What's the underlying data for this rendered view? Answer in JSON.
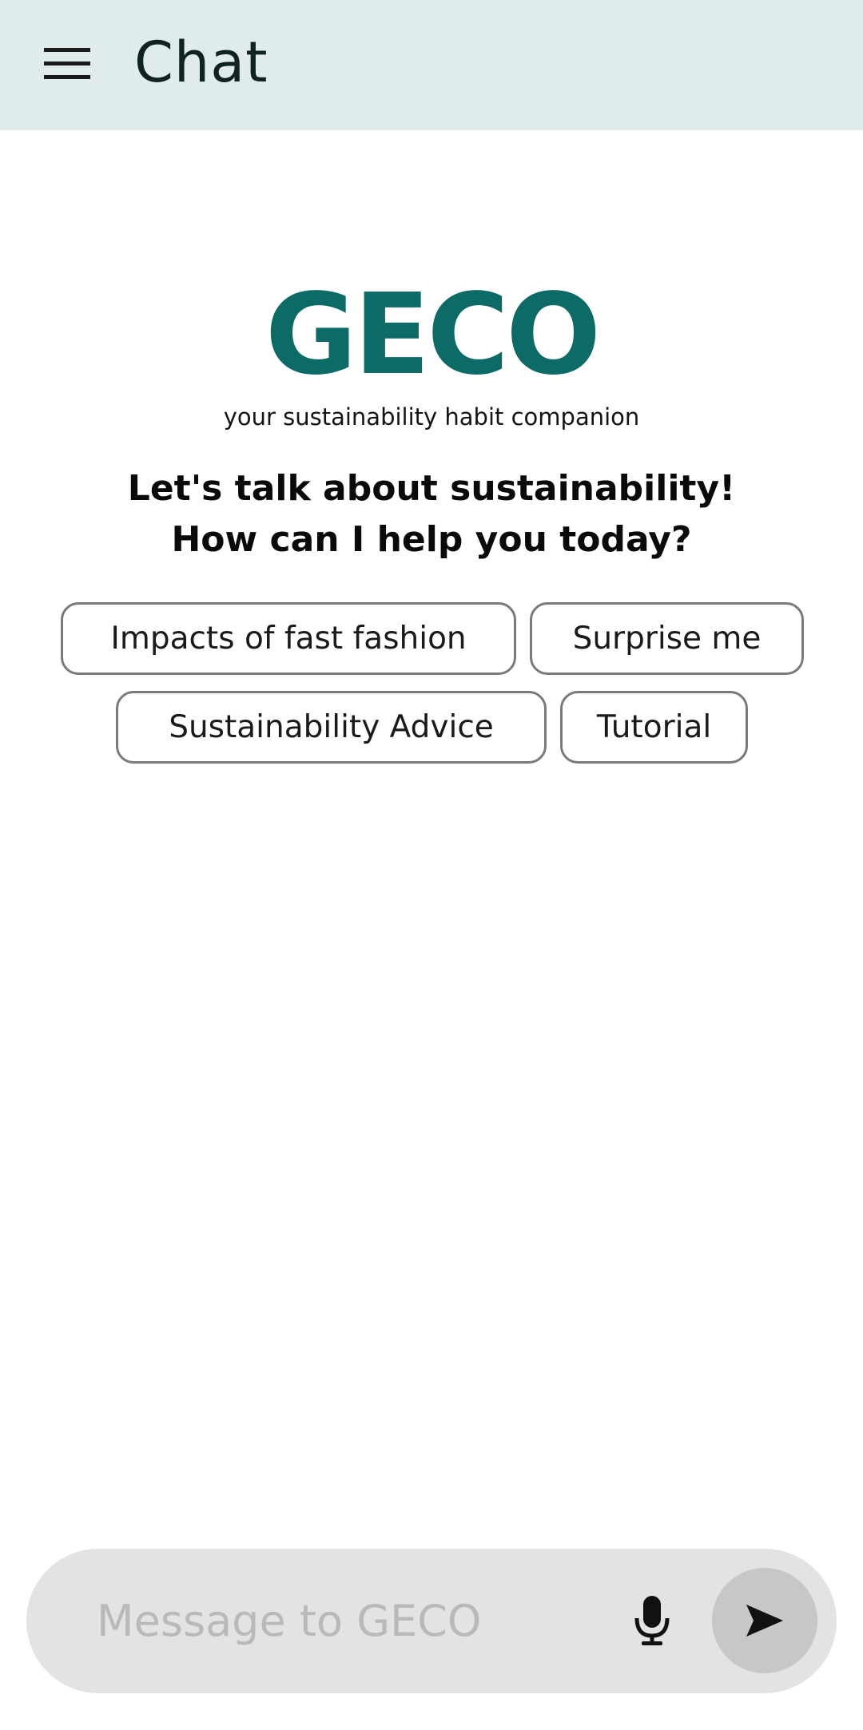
{
  "appbar": {
    "title": "Chat",
    "menu_icon": "hamburger-menu-icon"
  },
  "brand": {
    "logo": "GECO",
    "tagline": "your sustainability habit companion",
    "color": "#0c6b67"
  },
  "greeting": {
    "line1": "Let's talk about sustainability!",
    "line2": "How can I help you today?"
  },
  "suggestions": [
    {
      "label": "Impacts of fast fashion"
    },
    {
      "label": "Surprise me"
    },
    {
      "label": "Sustainability Advice"
    },
    {
      "label": "Tutorial"
    }
  ],
  "composer": {
    "placeholder": "Message to GECO",
    "value": "",
    "mic_icon": "microphone-icon",
    "send_icon": "send-icon"
  },
  "colors": {
    "appbar_bg": "#dfeceb",
    "composer_bg": "#e3e3e3",
    "send_bg": "#c7c7c7"
  }
}
